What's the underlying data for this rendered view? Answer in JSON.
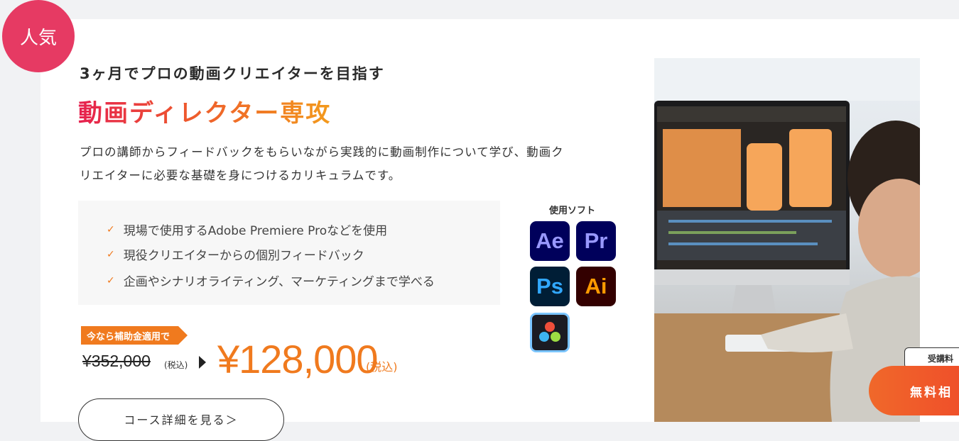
{
  "badge": {
    "label": "人気"
  },
  "course": {
    "subtitle": "3ヶ月でプロの動画クリエイターを目指す",
    "title": "動画ディレクター専攻",
    "description_line1": "プロの講師からフィードバックをもらいながら実践的に動画制作について学び、動画ク",
    "description_line2": "リエイターに必要な基礎を身につけるカリキュラムです。"
  },
  "features": [
    "現場で使用するAdobe Premiere Proなどを使用",
    "現役クリエイターからの個別フィードバック",
    "企画やシナリオライティング、マーケティングまで学べる"
  ],
  "software": {
    "label": "使用ソフト",
    "icons": [
      {
        "abbr": "Ae",
        "icon": "after-effects-icon"
      },
      {
        "abbr": "Pr",
        "icon": "premiere-pro-icon"
      },
      {
        "abbr": "Ps",
        "icon": "photoshop-icon"
      },
      {
        "abbr": "Ai",
        "icon": "illustrator-icon"
      },
      {
        "abbr": "",
        "icon": "davinci-resolve-icon"
      }
    ]
  },
  "pricing": {
    "promo_label": "今なら補助金適用で",
    "old_price": "¥352,000",
    "old_tax": "(税込)",
    "new_price": "¥128,000",
    "new_tax": "(税込)"
  },
  "detail_button": {
    "label": "コース詳細を見る＞"
  },
  "floating": {
    "tag_label": "受講料",
    "consult_label": "無料相"
  },
  "colors": {
    "accent_orange": "#f07a1e",
    "badge_pink": "#e63a63",
    "title_gradient_start": "#e6204f",
    "title_gradient_end": "#f39a1c"
  }
}
